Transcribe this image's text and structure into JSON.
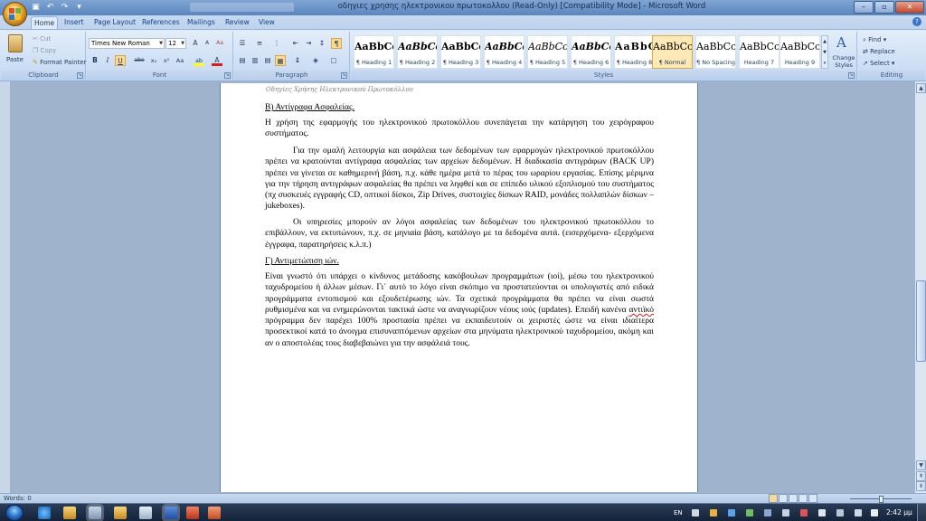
{
  "window": {
    "title": "οδηγιες χρησης ηλεκτρονικου πρωτοκολλου (Read-Only) [Compatibility Mode] - Microsoft Word",
    "minimize": "–",
    "maximize": "▫",
    "close": "✕"
  },
  "quick_access": [
    "save-icon",
    "undo-icon",
    "redo-icon",
    "customize-icon"
  ],
  "tabs": [
    "Home",
    "Insert",
    "Page Layout",
    "References",
    "Mailings",
    "Review",
    "View"
  ],
  "ribbon": {
    "clipboard": {
      "label": "Clipboard",
      "paste": "Paste",
      "cut": "Cut",
      "copy": "Copy",
      "format_painter": "Format Painter"
    },
    "font": {
      "label": "Font",
      "font_name": "Times New Roman",
      "font_size": "12",
      "grow": "A",
      "shrink": "A",
      "clear": "Aa",
      "bold": "B",
      "italic": "I",
      "underline": "U",
      "strike": "abe",
      "subscript": "x₂",
      "superscript": "x²",
      "change_case": "Aa",
      "highlight": "ab",
      "font_color": "A"
    },
    "paragraph": {
      "label": "Paragraph"
    },
    "styles": {
      "label": "Styles",
      "items": [
        {
          "preview": "AaBbCc",
          "name": "¶ Heading 1"
        },
        {
          "preview": "AaBbCc",
          "name": "¶ Heading 2"
        },
        {
          "preview": "AaBbCc",
          "name": "¶ Heading 3"
        },
        {
          "preview": "AaBbCc",
          "name": "¶ Heading 4"
        },
        {
          "preview": "AaBbCc.",
          "name": "¶ Heading 5"
        },
        {
          "preview": "AaBbCc",
          "name": "¶ Heading 6"
        },
        {
          "preview": "AaBbC",
          "name": "¶ Heading 8"
        },
        {
          "preview": "AaBbCcI",
          "name": "¶ Normal"
        },
        {
          "preview": "AaBbCcI",
          "name": "¶ No Spacing"
        },
        {
          "preview": "AaBbCcD",
          "name": "Heading 7"
        },
        {
          "preview": "AaBbCcDc",
          "name": "Heading 9"
        }
      ],
      "change_styles": "Change Styles"
    },
    "editing": {
      "label": "Editing",
      "find": "Find",
      "replace": "Replace",
      "select": "Select"
    }
  },
  "document": {
    "page_header": "Οδηγίες Χρήσης Ηλεκτρονικού Πρωτοκόλλου",
    "heading_b": "Β) Αντίγραφα Ασφαλείας.",
    "p1": "Η χρήση της εφαρμογής του ηλεκτρονικού πρωτοκόλλου συνεπάγεται την κατάργηση του χειρόγραφου συστήματος.",
    "p2": "Για την ομαλή λειτουργία και ασφάλεια των δεδομένων των εφαρμογών ηλεκτρονικού πρωτοκόλλου πρέπει να κρατούνται αντίγραφα ασφαλείας των αρχείων δεδομένων. Η διαδικασία αντιγράφων (BACK UP) πρέπει να γίνεται σε καθημερινή βάση, π.χ. κάθε ημέρα μετά το πέρας του ωραρίου εργασίας. Επίσης μέριμνα για την τήρηση αντιγράφων ασφαλείας θα πρέπει να ληφθεί και σε επίπεδο υλικού εξοπλισμού του συστήματος (πχ συσκευές εγγραφής CD, οπτικοί δίσκοι, Zip Drives, συστοιχίες δίσκων RAID, μονάδες πολλαπλών δίσκων – jukeboxes).",
    "p3": "Οι υπηρεσίες μπορούν αν λόγοι ασφαλείας των δεδομένων του ηλεκτρονικού πρωτοκόλλου το επιβάλλουν, να εκτυπώνουν, π.χ. σε μηνιαία βάση, κατάλογο με τα δεδομένα αυτά. (εισερχόμενα- εξερχόμενα έγγραφα, παρατηρήσεις κ.λ.π.)",
    "heading_c": "Γ) Αντιμετώπιση ιών.",
    "p4_before": "Είναι γνωστό ότι υπάρχει ο κίνδυνος μετάδοσης κακόβουλων προγραμμάτων (ιοί), μέσω του ηλεκτρονικού ταχυδρομείου ή άλλων μέσων. Γι΄ αυτό το λόγο είναι σκόπιμο να προστατεύονται οι υπολογιστές από ειδικά προγράμματα εντοπισμού και εξουδετέρωσης ιών. Τα σχετικά προγράμματα θα πρέπει να είναι σωστά ρυθμισμένα και να ενημερώνονται τακτικά ώστε να αναγνωρίζουν νέους ιούς (updates). Επειδή κανένα ",
    "p4_misspelled": "αντιϊκό",
    "p4_after": " πρόγραμμα δεν παρέχει 100% προστασία πρέπει να εκπαιδευτούν οι χειριστές ώστε να είναι ιδιαίτερα προσεκτικοί κατά το άνοιγμα επισυναπτόμενων αρχείων στα μηνύματα ηλεκτρονικού ταχυδρομείου, ακόμη και αν ο αποστολέας τους διαβεβαιώνει για την ασφάλειά τους."
  },
  "statusbar": {
    "words": "Words: 0"
  },
  "taskbar": {
    "language": "EN",
    "time": "2:42 μμ"
  },
  "colors": {
    "accent": "#1e395b",
    "ribbon": "#dfeaf7",
    "selected_style": "#fde9b6"
  }
}
